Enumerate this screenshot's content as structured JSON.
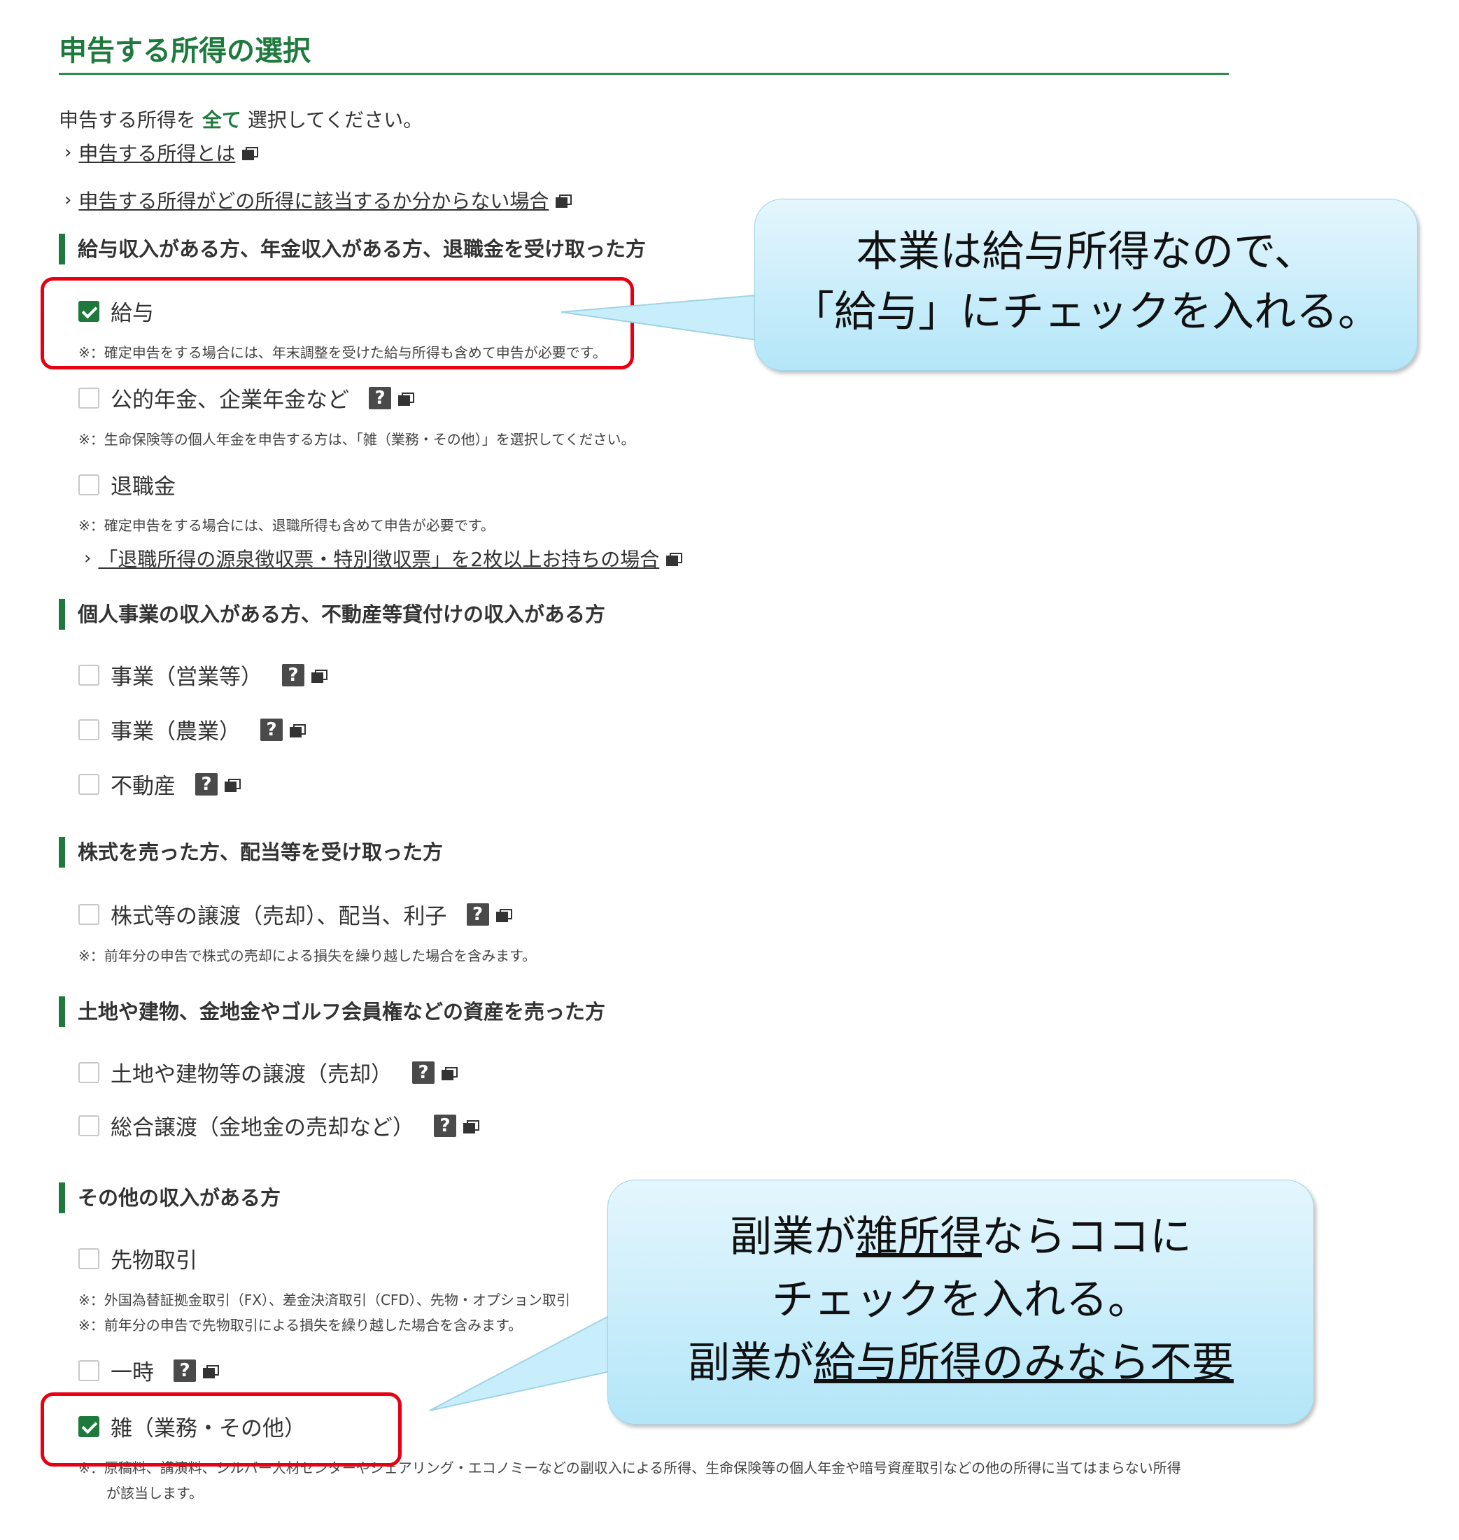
{
  "page_title": "申告する所得の選択",
  "instruction": {
    "before": "申告する所得を",
    "emphasis": "全て",
    "after": "選択してください。"
  },
  "links": {
    "what_is": "申告する所得とは",
    "unknown": "申告する所得がどの所得に該当するか分からない場合",
    "retirement_multi": "「退職所得の源泉徴収票・特別徴収票」を2枚以上お持ちの場合"
  },
  "sections": {
    "salary": {
      "heading": "給与収入がある方、年金収入がある方、退職金を受け取った方",
      "opt_salary": "給与",
      "note_salary": "※：確定申告をする場合には、年末調整を受けた給与所得も含めて申告が必要です。",
      "opt_pension": "公的年金、企業年金など",
      "note_pension": "※：生命保険等の個人年金を申告する方は、「雑（業務・その他）」を選択してください。",
      "opt_retirement": "退職金",
      "note_retirement": "※：確定申告をする場合には、退職所得も含めて申告が必要です。"
    },
    "business": {
      "heading": "個人事業の収入がある方、不動産等貸付けの収入がある方",
      "opt_business": "事業（営業等）",
      "opt_farm": "事業（農業）",
      "opt_realestate": "不動産"
    },
    "stock": {
      "heading": "株式を売った方、配当等を受け取った方",
      "opt_stock": "株式等の譲渡（売却）、配当、利子",
      "note_stock": "※：前年分の申告で株式の売却による損失を繰り越した場合を含みます。"
    },
    "assets": {
      "heading": "土地や建物、金地金やゴルフ会員権などの資産を売った方",
      "opt_land": "土地や建物等の譲渡（売却）",
      "opt_general": "総合譲渡（金地金の売却など）"
    },
    "other": {
      "heading": "その他の収入がある方",
      "opt_futures": "先物取引",
      "note_futures_1": "※：外国為替証拠金取引（FX）、差金決済取引（CFD）、先物・オプション取引",
      "note_futures_2": "※：前年分の申告で先物取引による損失を繰り越した場合を含みます。",
      "opt_temporary": "一時",
      "opt_misc": "雑（業務・その他）",
      "note_misc_1": "※：原稿料、講演料、シルバー人材センターやシェアリング・エコノミーなどの副収入による所得、生命保険等の個人年金や暗号資産取引などの他の所得に当てはまらない所得",
      "note_misc_2": "が該当します。"
    }
  },
  "help_glyph": "?",
  "chevron_glyph": "›",
  "callouts": {
    "top": {
      "line1": "本業は給与所得なので、",
      "line2": "「給与」にチェックを入れる。"
    },
    "bottom": {
      "l1_pre": "副業が",
      "l1_u": "雑所得",
      "l1_post": "ならココに",
      "l2": "チェックを入れる。",
      "l3_pre": "副業が",
      "l3_u": "給与所得のみなら不要"
    }
  },
  "colors": {
    "accent_green": "#1e7a3c",
    "highlight_red": "#e60012",
    "bubble_blue": "#b3e6f8"
  }
}
